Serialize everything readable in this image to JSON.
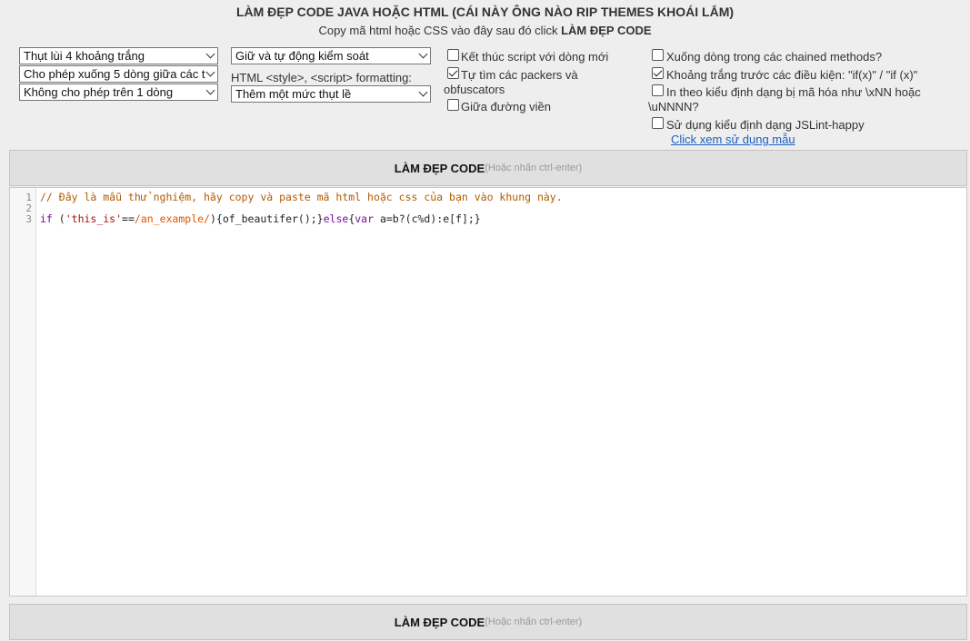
{
  "header": {
    "title": "LÀM ĐẸP CODE JAVA HOẶC HTML (CÁI NÀY ÔNG NÀO RIP THEMES KHOÁI LẮM)",
    "subtitle_prefix": "Copy mã html hoặc CSS vào đây sau đó click",
    "subtitle_action": "LÀM ĐẸP CODE"
  },
  "options": {
    "indent_select": "Thụt lùi 4 khoảng trắng",
    "newlines_select": "Cho phép xuống 5 dòng giữa các t",
    "wrap_select": "Không cho phép trên 1 dòng",
    "brace_select": "Giữ và tự động kiểm soát",
    "style_script_label": "HTML <style>, <script> formatting:",
    "style_script_select": "Thêm một mức thụt lề"
  },
  "checkboxes": {
    "end_newline": {
      "label": "Kết thúc script với dòng mới",
      "checked": false
    },
    "detect_packers_line1": "Tự tìm các packers và",
    "detect_packers_line2": "obfuscators",
    "detect_packers_checked": true,
    "keep_array_indent": {
      "label": "Giữa đường viền",
      "checked": false
    },
    "break_chained": {
      "label": "Xuống dòng trong các chained methods?",
      "checked": false
    },
    "space_before_cond": {
      "label": "Khoảng trắng trước các điều kiện: \"if(x)\" / \"if (x)\"",
      "checked": true
    },
    "unescape_line1": "In theo kiểu định dạng bị mã hóa như \\xNN hoặc",
    "unescape_line2": "\\uNNNN?",
    "unescape_checked": false,
    "jslint": {
      "label": "Sử dụng kiểu định dạng JSLint-happy",
      "checked": false
    }
  },
  "links": {
    "sample": "Click xem sử dụng mẫu"
  },
  "buttons": {
    "beautify_label": "LÀM ĐẸP CODE",
    "beautify_hint": "(Hoặc nhấn ctrl-enter)"
  },
  "editor": {
    "line_numbers": [
      "1",
      "2",
      "3"
    ],
    "line1_comment": "// Đây là mẫu thử nghiệm, hãy copy và paste mã html hoặc css của bạn vào khung này.",
    "line3": {
      "kw_if": "if",
      "p1": " (",
      "str": "'this_is'",
      "op": "==",
      "re": "/an_example/",
      "p2": "){of_beautifer();}",
      "kw_else": "else",
      "p3": "{",
      "kw_var": "var",
      "p4": " a=b?(c%d):e[f];}"
    }
  }
}
